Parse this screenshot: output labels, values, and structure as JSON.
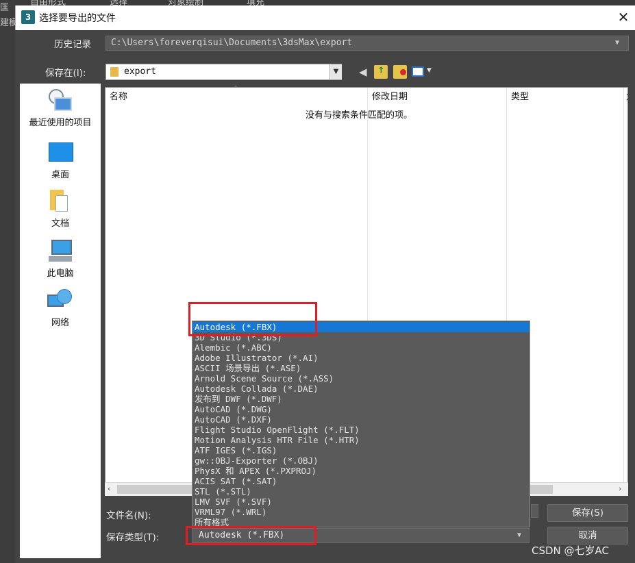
{
  "background_app": {
    "menu_items": [
      "自由形式",
      "选择",
      "对象绘制",
      "填充"
    ],
    "side_label_top": "匡",
    "side_label": "建模"
  },
  "dialog": {
    "app_icon": "3",
    "title": "选择要导出的文件",
    "close_icon": "close-icon"
  },
  "history": {
    "label": "历史记录",
    "value": "C:\\Users\\foreverqisui\\Documents\\3dsMax\\export"
  },
  "save_in": {
    "label": "保存在(I):",
    "value": "export",
    "toolbar_icons": [
      "back-arrow-icon",
      "up-folder-icon",
      "new-folder-icon",
      "view-menu-icon"
    ]
  },
  "places": [
    {
      "label": "最近使用的项目",
      "icon": "recent-items-icon"
    },
    {
      "label": "桌面",
      "icon": "desktop-icon"
    },
    {
      "label": "文档",
      "icon": "documents-icon"
    },
    {
      "label": "此电脑",
      "icon": "this-pc-icon"
    },
    {
      "label": "网络",
      "icon": "network-icon"
    }
  ],
  "file_list": {
    "columns": [
      "名称",
      "修改日期",
      "类型",
      "大"
    ],
    "empty_message": "没有与搜索条件匹配的项。"
  },
  "filename": {
    "label": "文件名(N):",
    "value": ""
  },
  "filetype": {
    "label": "保存类型(T):",
    "value": "Autodesk (*.FBX)",
    "options": [
      "Autodesk (*.FBX)",
      "3D Studio (*.3DS)",
      "Alembic (*.ABC)",
      "Adobe Illustrator (*.AI)",
      "ASCII 场景导出 (*.ASE)",
      "Arnold Scene Source (*.ASS)",
      "Autodesk Collada (*.DAE)",
      "发布到 DWF (*.DWF)",
      "AutoCAD (*.DWG)",
      "AutoCAD (*.DXF)",
      "Flight Studio OpenFlight (*.FLT)",
      "Motion Analysis HTR File (*.HTR)",
      "ATF IGES (*.IGS)",
      "gw::OBJ-Exporter (*.OBJ)",
      "PhysX 和 APEX (*.PXPROJ)",
      "ACIS SAT (*.SAT)",
      "STL (*.STL)",
      "LMV SVF (*.SVF)",
      "VRML97 (*.WRL)",
      "所有格式"
    ],
    "selected_index": 0
  },
  "buttons": {
    "save": "保存(S)",
    "cancel": "取消"
  },
  "watermark": "CSDN @七岁AC",
  "colors": {
    "highlight": "#1677d4",
    "annotation_box": "#e31b23",
    "dialog_bg": "#444444"
  }
}
